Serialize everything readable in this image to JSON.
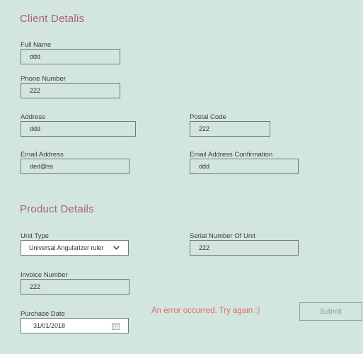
{
  "client_section": {
    "title": "Client Detalis",
    "full_name": {
      "label": "Full Name",
      "value": "ddd"
    },
    "phone": {
      "label": "Phone Number",
      "value": "222"
    },
    "address": {
      "label": "Address",
      "value": "ddd"
    },
    "postal_code": {
      "label": "Postal Code",
      "value": "222"
    },
    "email": {
      "label": "Email Address",
      "value": "ded@ss"
    },
    "email_confirm": {
      "label": "Email Address Confirmation",
      "value": "ddd"
    }
  },
  "product_section": {
    "title": "Product Details",
    "unit_type": {
      "label": "Unit Type",
      "value": "Universal Angularizer ruler"
    },
    "serial_number": {
      "label": "Serial Number Of Unit",
      "value": "222"
    },
    "invoice_number": {
      "label": "Invoice Number",
      "value": "222"
    },
    "purchase_date": {
      "label": "Purchase Date",
      "value": "31/01/2018"
    }
  },
  "error_message": "An error occurred. Try again :)",
  "submit_label": "Submit",
  "colors": {
    "background": "#d2e6df",
    "title": "#a8607a",
    "error": "#e26a6a"
  },
  "icons": {
    "dropdown": "chevron-down-icon",
    "date": "calendar-icon"
  }
}
